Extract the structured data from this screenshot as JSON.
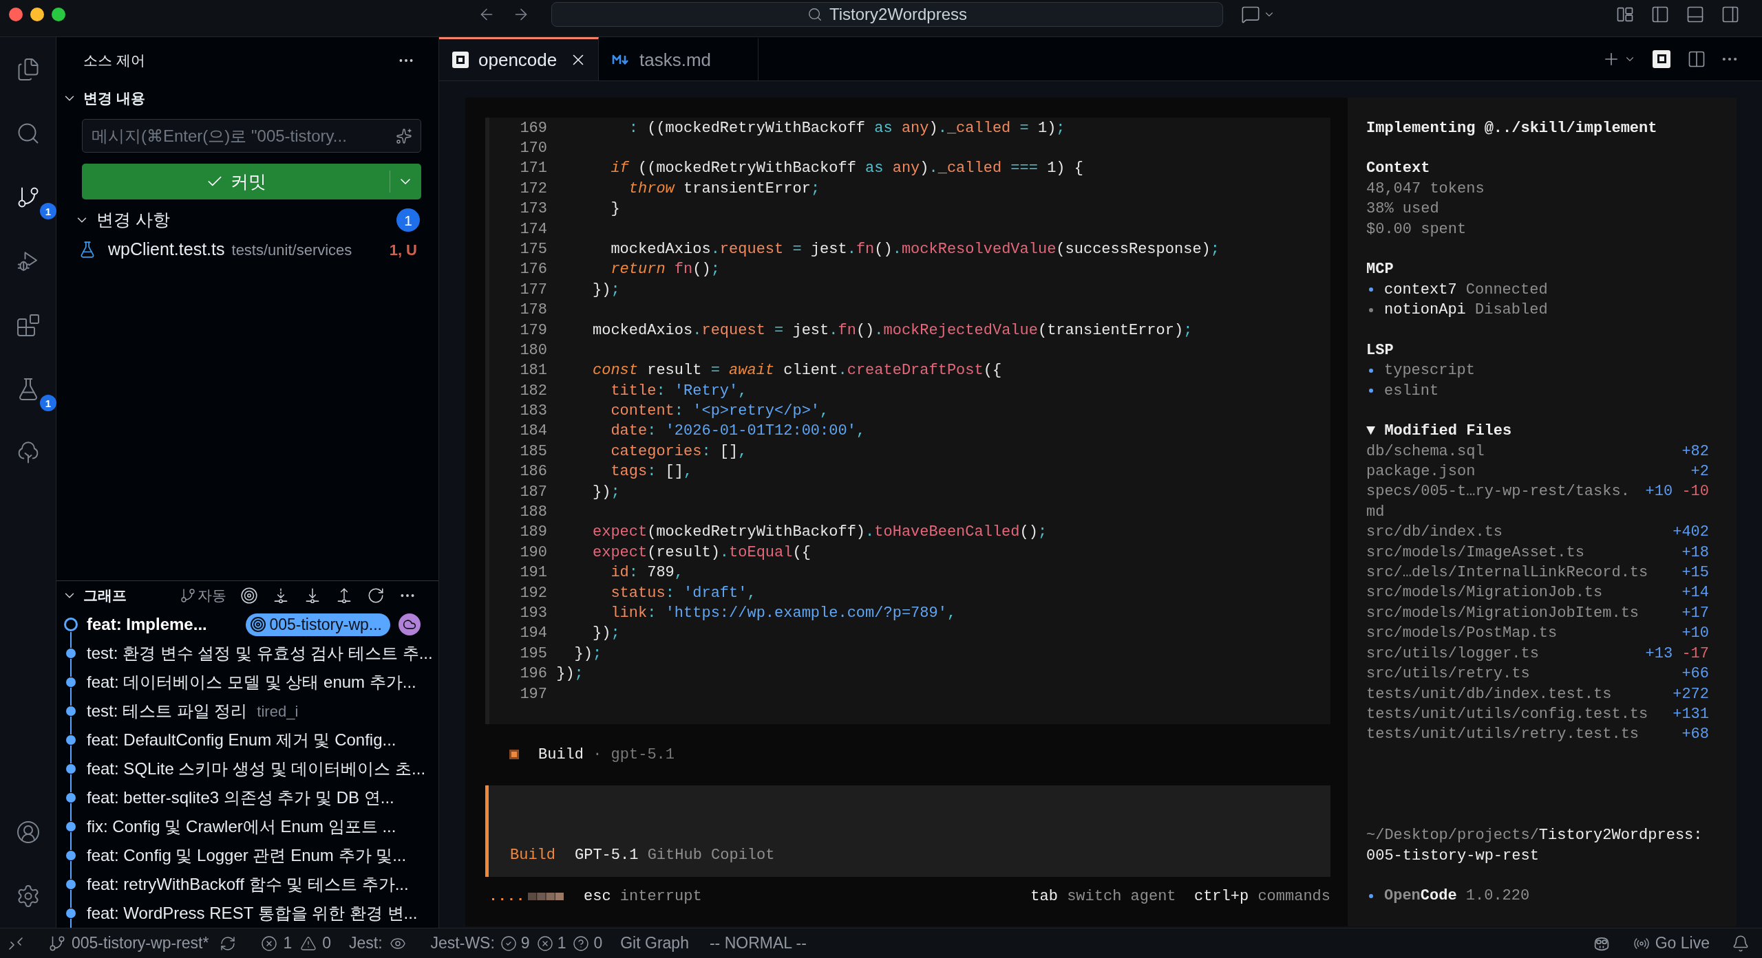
{
  "window": {
    "title": "Tistory2Wordpress"
  },
  "activity_bar": {
    "items": [
      {
        "kind": "explorer",
        "selected": false
      },
      {
        "kind": "search",
        "selected": false
      },
      {
        "kind": "source-control",
        "selected": true,
        "badge": "1"
      },
      {
        "kind": "run-debug",
        "selected": false
      },
      {
        "kind": "extensions",
        "selected": false
      },
      {
        "kind": "testing",
        "selected": false,
        "badge": "1"
      },
      {
        "kind": "git-graph",
        "selected": false
      }
    ],
    "bottom_items": [
      {
        "kind": "account"
      },
      {
        "kind": "settings"
      }
    ]
  },
  "sidebar": {
    "title": "소스 제어",
    "changes_panel": {
      "title": "변경 내용",
      "expanded": true,
      "message_field": {
        "placeholder": "메시지(⌘Enter(으)로 \"005-tistory..."
      },
      "commit_button": {
        "label": "커밋"
      },
      "changes": {
        "title": "변경 사항",
        "expanded": true,
        "count": "1",
        "files": [
          {
            "name": "wpClient.test.ts",
            "path": "tests/unit/services",
            "status": "1, U"
          }
        ]
      }
    },
    "graph": {
      "title": "그래프",
      "expanded": true,
      "auto_label": "자동",
      "commits": [
        {
          "message": "feat: Impleme...",
          "head": true,
          "branch": "005-tistory-wp...",
          "remote": true
        },
        {
          "message": "test: 환경 변수 설정 및 유효성 검사 테스트 추...",
          "head": false,
          "remote": false
        },
        {
          "message": "feat: 데이터베이스 모델 및 상태 enum 추가...",
          "head": false,
          "remote": false
        },
        {
          "message": "test: 테스트 파일 정리",
          "head": false,
          "remote": false,
          "author": "tired_i"
        },
        {
          "message": "feat: DefaultConfig Enum 제거 및 Config...",
          "head": false,
          "remote": false
        },
        {
          "message": "feat: SQLite 스키마 생성 및 데이터베이스 초...",
          "head": false,
          "remote": false
        },
        {
          "message": "feat: better-sqlite3 의존성 추가 및 DB 연...",
          "head": false,
          "remote": false
        },
        {
          "message": "fix: Config 및 Crawler에서 Enum 임포트 ...",
          "head": false,
          "remote": false
        },
        {
          "message": "feat: Config 및 Logger 관련 Enum 추가 및...",
          "head": false,
          "remote": false
        },
        {
          "message": "feat: retryWithBackoff 함수 및 테스트 추가...",
          "head": false,
          "remote": false
        },
        {
          "message": "feat: WordPress REST 통합을 위한 환경 변...",
          "head": false,
          "remote": false
        }
      ]
    }
  },
  "editor": {
    "tabs": [
      {
        "label": "opencode",
        "kind": "terminal",
        "selected": true
      },
      {
        "label": "tasks.md",
        "kind": "markdown",
        "selected": false
      }
    ],
    "opencode": {
      "code_lines": [
        {
          "number": "169",
          "tokens": [
            {
              "kind": "operator",
              "text": "        :"
            },
            {
              "kind": "plain",
              "text": " ((mockedRetryWithBackoff "
            },
            {
              "kind": "operator",
              "text": "as "
            },
            {
              "kind": "type",
              "text": "any"
            },
            {
              "kind": "plain",
              "text": ")"
            },
            {
              "kind": "operator",
              "text": "."
            },
            {
              "kind": "property",
              "text": "_called"
            },
            {
              "kind": "operator",
              "text": " = "
            },
            {
              "kind": "plain",
              "text": "1)"
            },
            {
              "kind": "operator",
              "text": ";"
            }
          ]
        },
        {
          "number": "170"
        },
        {
          "number": "171",
          "tokens": [
            {
              "kind": "keyword",
              "text": "      if"
            },
            {
              "kind": "plain",
              "text": " ((mockedRetryWithBackoff "
            },
            {
              "kind": "operator",
              "text": "as "
            },
            {
              "kind": "type",
              "text": "any"
            },
            {
              "kind": "plain",
              "text": ")"
            },
            {
              "kind": "operator",
              "text": "."
            },
            {
              "kind": "property",
              "text": "_called"
            },
            {
              "kind": "operator",
              "text": " === "
            },
            {
              "kind": "plain",
              "text": "1) {"
            }
          ]
        },
        {
          "number": "172",
          "tokens": [
            {
              "kind": "keyword",
              "text": "        throw"
            },
            {
              "kind": "plain",
              "text": " transientError"
            },
            {
              "kind": "operator",
              "text": ";"
            }
          ]
        },
        {
          "number": "173",
          "tokens": [
            {
              "kind": "plain",
              "text": "      }"
            }
          ]
        },
        {
          "number": "174"
        },
        {
          "number": "175",
          "tokens": [
            {
              "kind": "plain",
              "text": "      mockedAxios"
            },
            {
              "kind": "operator",
              "text": "."
            },
            {
              "kind": "property",
              "text": "request"
            },
            {
              "kind": "operator",
              "text": " = "
            },
            {
              "kind": "plain",
              "text": "jest"
            },
            {
              "kind": "operator",
              "text": "."
            },
            {
              "kind": "function",
              "text": "fn"
            },
            {
              "kind": "plain",
              "text": "()"
            },
            {
              "kind": "operator",
              "text": "."
            },
            {
              "kind": "function",
              "text": "mockResolvedValue"
            },
            {
              "kind": "plain",
              "text": "(successResponse)"
            },
            {
              "kind": "operator",
              "text": ";"
            }
          ]
        },
        {
          "number": "176",
          "tokens": [
            {
              "kind": "keyword",
              "text": "      return"
            },
            {
              "kind": "function",
              "text": " fn"
            },
            {
              "kind": "plain",
              "text": "()"
            },
            {
              "kind": "operator",
              "text": ";"
            }
          ]
        },
        {
          "number": "177",
          "tokens": [
            {
              "kind": "plain",
              "text": "    })"
            },
            {
              "kind": "operator",
              "text": ";"
            }
          ]
        },
        {
          "number": "178"
        },
        {
          "number": "179",
          "tokens": [
            {
              "kind": "plain",
              "text": "    mockedAxios"
            },
            {
              "kind": "operator",
              "text": "."
            },
            {
              "kind": "property",
              "text": "request"
            },
            {
              "kind": "operator",
              "text": " = "
            },
            {
              "kind": "plain",
              "text": "jest"
            },
            {
              "kind": "operator",
              "text": "."
            },
            {
              "kind": "function",
              "text": "fn"
            },
            {
              "kind": "plain",
              "text": "()"
            },
            {
              "kind": "operator",
              "text": "."
            },
            {
              "kind": "function",
              "text": "mockRejectedValue"
            },
            {
              "kind": "plain",
              "text": "(transientError)"
            },
            {
              "kind": "operator",
              "text": ";"
            }
          ]
        },
        {
          "number": "180"
        },
        {
          "number": "181",
          "tokens": [
            {
              "kind": "keyword",
              "text": "    const"
            },
            {
              "kind": "plain",
              "text": " result"
            },
            {
              "kind": "operator",
              "text": " = "
            },
            {
              "kind": "keyword",
              "text": "await"
            },
            {
              "kind": "plain",
              "text": " client"
            },
            {
              "kind": "operator",
              "text": "."
            },
            {
              "kind": "function",
              "text": "createDraftPost"
            },
            {
              "kind": "plain",
              "text": "({"
            }
          ]
        },
        {
          "number": "182",
          "tokens": [
            {
              "kind": "property",
              "text": "      title"
            },
            {
              "kind": "operator",
              "text": ": "
            },
            {
              "kind": "string",
              "text": "'Retry'"
            },
            {
              "kind": "operator",
              "text": ","
            }
          ]
        },
        {
          "number": "183",
          "tokens": [
            {
              "kind": "property",
              "text": "      content"
            },
            {
              "kind": "operator",
              "text": ": "
            },
            {
              "kind": "string",
              "text": "'<p>retry</p>'"
            },
            {
              "kind": "operator",
              "text": ","
            }
          ]
        },
        {
          "number": "184",
          "tokens": [
            {
              "kind": "property",
              "text": "      date"
            },
            {
              "kind": "operator",
              "text": ": "
            },
            {
              "kind": "string",
              "text": "'2026-01-01T12:00:00'"
            },
            {
              "kind": "operator",
              "text": ","
            }
          ]
        },
        {
          "number": "185",
          "tokens": [
            {
              "kind": "property",
              "text": "      categories"
            },
            {
              "kind": "operator",
              "text": ":"
            },
            {
              "kind": "plain",
              "text": " []"
            },
            {
              "kind": "operator",
              "text": ","
            }
          ]
        },
        {
          "number": "186",
          "tokens": [
            {
              "kind": "property",
              "text": "      tags"
            },
            {
              "kind": "operator",
              "text": ":"
            },
            {
              "kind": "plain",
              "text": " []"
            },
            {
              "kind": "operator",
              "text": ","
            }
          ]
        },
        {
          "number": "187",
          "tokens": [
            {
              "kind": "plain",
              "text": "    })"
            },
            {
              "kind": "operator",
              "text": ";"
            }
          ]
        },
        {
          "number": "188"
        },
        {
          "number": "189",
          "tokens": [
            {
              "kind": "function",
              "text": "    expect"
            },
            {
              "kind": "plain",
              "text": "(mockedRetryWithBackoff)"
            },
            {
              "kind": "operator",
              "text": "."
            },
            {
              "kind": "function",
              "text": "toHaveBeenCalled"
            },
            {
              "kind": "plain",
              "text": "()"
            },
            {
              "kind": "operator",
              "text": ";"
            }
          ]
        },
        {
          "number": "190",
          "tokens": [
            {
              "kind": "function",
              "text": "    expect"
            },
            {
              "kind": "plain",
              "text": "(result)"
            },
            {
              "kind": "operator",
              "text": "."
            },
            {
              "kind": "function",
              "text": "toEqual"
            },
            {
              "kind": "plain",
              "text": "({"
            }
          ]
        },
        {
          "number": "191",
          "tokens": [
            {
              "kind": "property",
              "text": "      id"
            },
            {
              "kind": "operator",
              "text": ":"
            },
            {
              "kind": "plain",
              "text": " 789"
            },
            {
              "kind": "operator",
              "text": ","
            }
          ]
        },
        {
          "number": "192",
          "tokens": [
            {
              "kind": "property",
              "text": "      status"
            },
            {
              "kind": "operator",
              "text": ": "
            },
            {
              "kind": "string",
              "text": "'draft'"
            },
            {
              "kind": "operator",
              "text": ","
            }
          ]
        },
        {
          "number": "193",
          "tokens": [
            {
              "kind": "property",
              "text": "      link"
            },
            {
              "kind": "operator",
              "text": ": "
            },
            {
              "kind": "string",
              "text": "'https://wp.example.com/?p=789'"
            },
            {
              "kind": "operator",
              "text": ","
            }
          ]
        },
        {
          "number": "194",
          "tokens": [
            {
              "kind": "plain",
              "text": "    })"
            },
            {
              "kind": "operator",
              "text": ";"
            }
          ]
        },
        {
          "number": "195",
          "tokens": [
            {
              "kind": "plain",
              "text": "  })"
            },
            {
              "kind": "operator",
              "text": ";"
            }
          ]
        },
        {
          "number": "196",
          "tokens": [
            {
              "kind": "plain",
              "text": "})"
            },
            {
              "kind": "operator",
              "text": ";"
            }
          ]
        },
        {
          "number": "197"
        }
      ],
      "status": {
        "agent": "Build",
        "separator": "·",
        "model": "gpt-5.1"
      },
      "prompt": {
        "agent": "Build",
        "model": "GPT-5.1",
        "provider": "GitHub Copilot"
      },
      "hints_left": [
        {
          "key": "esc",
          "action": "interrupt"
        }
      ],
      "hints_right": [
        {
          "key": "tab",
          "action": "switch agent"
        },
        {
          "key": "ctrl+p",
          "action": "commands"
        }
      ],
      "session": {
        "title": "Implementing @../skill/implement",
        "context": {
          "heading": "Context",
          "stats": [
            "48,047 tokens",
            "38% used",
            "$0.00 spent"
          ]
        },
        "mcp": {
          "heading": "MCP",
          "servers": [
            {
              "name": "context7",
              "status": "Connected",
              "color": "#5c9cf5"
            },
            {
              "name": "notionApi",
              "status": "Disabled",
              "color": "#808080"
            }
          ]
        },
        "lsp": {
          "heading": "LSP",
          "servers": [
            {
              "name": "typescript",
              "color": "#5c9cf5"
            },
            {
              "name": "eslint",
              "color": "#5c9cf5"
            }
          ]
        },
        "modified_files": {
          "toggle": "▼",
          "heading": "Modified Files",
          "files": [
            {
              "path": "db/schema.sql",
              "additions": "+82"
            },
            {
              "path": "package.json",
              "additions": "+2"
            },
            {
              "path": "specs/005-t…ry-wp-rest/tasks.md",
              "additions": "+10",
              "deletions": "-10"
            },
            {
              "path": "src/db/index.ts",
              "additions": "+402"
            },
            {
              "path": "src/models/ImageAsset.ts",
              "additions": "+18"
            },
            {
              "path": "src/…dels/InternalLinkRecord.ts",
              "additions": "+15"
            },
            {
              "path": "src/models/MigrationJob.ts",
              "additions": "+14"
            },
            {
              "path": "src/models/MigrationJobItem.ts",
              "additions": "+17"
            },
            {
              "path": "src/models/PostMap.ts",
              "additions": "+10"
            },
            {
              "path": "src/utils/logger.ts",
              "additions": "+13",
              "deletions": "-17"
            },
            {
              "path": "src/utils/retry.ts",
              "additions": "+66"
            },
            {
              "path": "tests/unit/db/index.test.ts",
              "additions": "+272"
            },
            {
              "path": "tests/unit/utils/config.test.ts",
              "additions": "+131"
            },
            {
              "path": "tests/unit/utils/retry.test.ts",
              "additions": "+68"
            }
          ]
        },
        "directory": "~/Desktop/projects/",
        "project": "Tistory2Wordpress:",
        "branch": "005-tistory-wp-rest",
        "app": {
          "name_parts": [
            "Open",
            "Code"
          ],
          "version": "1.0.220"
        }
      }
    }
  },
  "status_bar": {
    "branch": "005-tistory-wp-rest*",
    "errors": "1",
    "warnings": "0",
    "jest": "Jest:",
    "jest_ws": "Jest-WS:",
    "passed": "9",
    "failed": "1",
    "unknown": "0",
    "git_graph": "Git Graph",
    "vim_mode": "-- NORMAL --",
    "go_live": "Go Live"
  }
}
